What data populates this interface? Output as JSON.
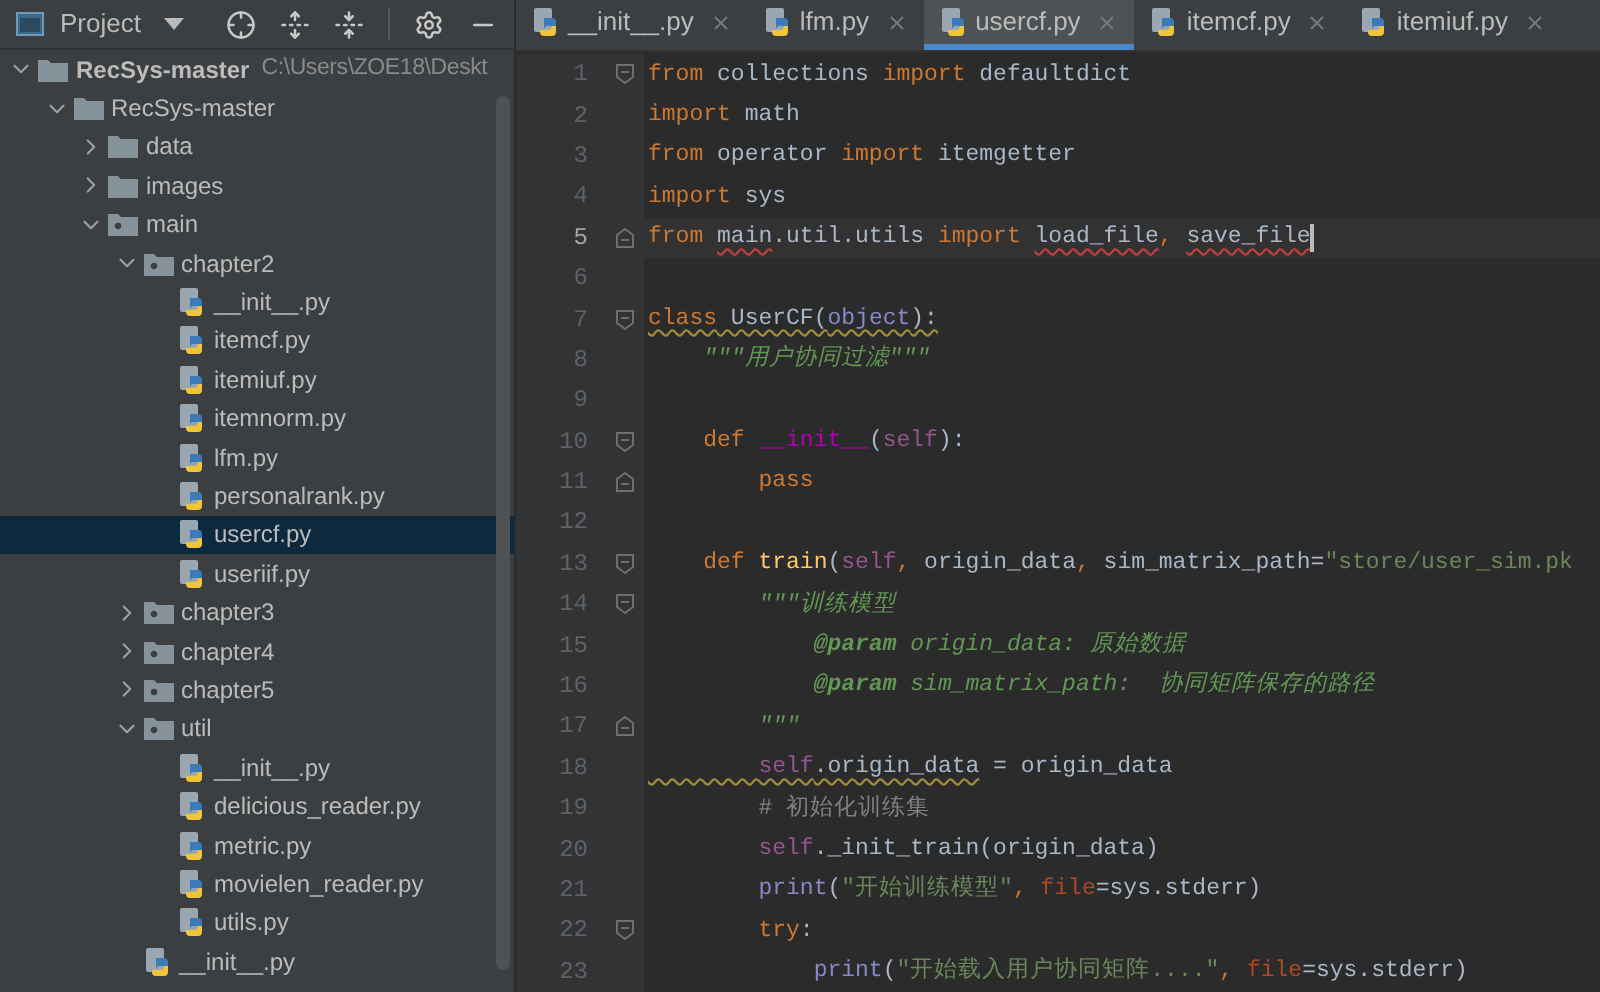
{
  "project_panel": {
    "title": "Project",
    "tree": [
      {
        "name": "RecSys-master",
        "path": "C:\\Users\\ZOE18\\Deskt",
        "kind": "folder",
        "expanded": true,
        "selected": false,
        "children": [
          {
            "name": "RecSys-master",
            "kind": "folder",
            "expanded": true,
            "selected": false,
            "children": [
              {
                "name": "data",
                "kind": "folder",
                "expanded": false,
                "selected": false
              },
              {
                "name": "images",
                "kind": "folder",
                "expanded": false,
                "selected": false
              },
              {
                "name": "main",
                "kind": "module",
                "expanded": true,
                "selected": false,
                "children": [
                  {
                    "name": "chapter2",
                    "kind": "module",
                    "expanded": true,
                    "selected": false,
                    "children": [
                      {
                        "name": "__init__.py",
                        "kind": "python",
                        "selected": false
                      },
                      {
                        "name": "itemcf.py",
                        "kind": "python",
                        "selected": false
                      },
                      {
                        "name": "itemiuf.py",
                        "kind": "python",
                        "selected": false
                      },
                      {
                        "name": "itemnorm.py",
                        "kind": "python",
                        "selected": false
                      },
                      {
                        "name": "lfm.py",
                        "kind": "python",
                        "selected": false
                      },
                      {
                        "name": "personalrank.py",
                        "kind": "python",
                        "selected": false
                      },
                      {
                        "name": "usercf.py",
                        "kind": "python",
                        "selected": true
                      },
                      {
                        "name": "useriif.py",
                        "kind": "python",
                        "selected": false
                      }
                    ]
                  },
                  {
                    "name": "chapter3",
                    "kind": "module",
                    "expanded": false,
                    "selected": false
                  },
                  {
                    "name": "chapter4",
                    "kind": "module",
                    "expanded": false,
                    "selected": false
                  },
                  {
                    "name": "chapter5",
                    "kind": "module",
                    "expanded": false,
                    "selected": false
                  },
                  {
                    "name": "util",
                    "kind": "module",
                    "expanded": true,
                    "selected": false,
                    "children": [
                      {
                        "name": "__init__.py",
                        "kind": "python",
                        "selected": false
                      },
                      {
                        "name": "delicious_reader.py",
                        "kind": "python",
                        "selected": false
                      },
                      {
                        "name": "metric.py",
                        "kind": "python",
                        "selected": false
                      },
                      {
                        "name": "movielen_reader.py",
                        "kind": "python",
                        "selected": false
                      },
                      {
                        "name": "utils.py",
                        "kind": "python",
                        "selected": false
                      }
                    ]
                  },
                  {
                    "name": "__init__.py",
                    "kind": "python",
                    "selected": false
                  }
                ]
              }
            ]
          }
        ]
      }
    ]
  },
  "editor_tabs": [
    {
      "label": "__init__.py",
      "selected": false
    },
    {
      "label": "lfm.py",
      "selected": false
    },
    {
      "label": "usercf.py",
      "selected": true
    },
    {
      "label": "itemcf.py",
      "selected": false
    },
    {
      "label": "itemiuf.py",
      "selected": false
    }
  ],
  "code_lines": [
    {
      "number": "1",
      "current": false,
      "fold_start": true,
      "fold_end": false,
      "tokens": [
        {
          "text": "from",
          "kind": "kw"
        },
        {
          "text": " collections ",
          "kind": "plain"
        },
        {
          "text": "import",
          "kind": "kw"
        },
        {
          "text": " defaultdict",
          "kind": "plain"
        }
      ]
    },
    {
      "number": "2",
      "current": false,
      "fold_start": false,
      "fold_end": false,
      "tokens": [
        {
          "text": "import",
          "kind": "kw"
        },
        {
          "text": " math",
          "kind": "plain"
        }
      ]
    },
    {
      "number": "3",
      "current": false,
      "fold_start": false,
      "fold_end": false,
      "tokens": [
        {
          "text": "from",
          "kind": "kw"
        },
        {
          "text": " operator ",
          "kind": "plain"
        },
        {
          "text": "import",
          "kind": "kw"
        },
        {
          "text": " itemgetter",
          "kind": "plain"
        }
      ]
    },
    {
      "number": "4",
      "current": false,
      "fold_start": false,
      "fold_end": false,
      "tokens": [
        {
          "text": "import",
          "kind": "kw"
        },
        {
          "text": " sys",
          "kind": "plain"
        }
      ]
    },
    {
      "number": "5",
      "current": true,
      "fold_start": false,
      "fold_end": true,
      "tokens": [
        {
          "text": "from ",
          "kind": "kw"
        },
        {
          "text": "main",
          "kind": "plain",
          "error": true
        },
        {
          "text": ".util.utils ",
          "kind": "plain"
        },
        {
          "text": "import ",
          "kind": "kw"
        },
        {
          "text": "load_file",
          "kind": "plain",
          "error": true
        },
        {
          "text": ", ",
          "kind": "kw"
        },
        {
          "text": "save_file",
          "kind": "plain",
          "error": true
        }
      ]
    },
    {
      "number": "6",
      "current": false,
      "fold_start": false,
      "fold_end": false
    },
    {
      "number": "7",
      "current": false,
      "fold_start": true,
      "fold_end": false,
      "tokens": [
        {
          "text": "class",
          "kind": "kw",
          "warning": true
        },
        {
          "text": " UserCF(",
          "kind": "plain",
          "warning": true
        },
        {
          "text": "object",
          "kind": "builtin",
          "warning": true
        },
        {
          "text": "):",
          "kind": "plain",
          "warning": true
        }
      ]
    },
    {
      "number": "8",
      "current": false,
      "fold_start": false,
      "fold_end": false,
      "tokens": [
        {
          "text": "    \"\"\"用户协同过滤\"\"\"",
          "kind": "doc"
        }
      ]
    },
    {
      "number": "9",
      "current": false,
      "fold_start": false,
      "fold_end": false
    },
    {
      "number": "10",
      "current": false,
      "fold_start": true,
      "fold_end": false,
      "tokens": [
        {
          "text": "    def ",
          "kind": "kw"
        },
        {
          "text": "__init__",
          "kind": "magic"
        },
        {
          "text": "(",
          "kind": "plain"
        },
        {
          "text": "self",
          "kind": "self"
        },
        {
          "text": "):",
          "kind": "plain"
        }
      ]
    },
    {
      "number": "11",
      "current": false,
      "fold_start": false,
      "fold_end": true,
      "tokens": [
        {
          "text": "        pass",
          "kind": "kw"
        }
      ]
    },
    {
      "number": "12",
      "current": false,
      "fold_start": false,
      "fold_end": false
    },
    {
      "number": "13",
      "current": false,
      "fold_start": true,
      "fold_end": false,
      "tokens": [
        {
          "text": "    def ",
          "kind": "kw"
        },
        {
          "text": "train",
          "kind": "fn"
        },
        {
          "text": "(",
          "kind": "plain"
        },
        {
          "text": "self",
          "kind": "self"
        },
        {
          "text": ",",
          "kind": "kw"
        },
        {
          "text": " origin_data",
          "kind": "plain"
        },
        {
          "text": ",",
          "kind": "kw"
        },
        {
          "text": " sim_matrix_path=",
          "kind": "plain"
        },
        {
          "text": "\"store/user_sim.pk",
          "kind": "str"
        }
      ]
    },
    {
      "number": "14",
      "current": false,
      "fold_start": true,
      "fold_end": false,
      "tokens": [
        {
          "text": "        \"\"\"训练模型",
          "kind": "doc"
        }
      ]
    },
    {
      "number": "15",
      "current": false,
      "fold_start": false,
      "fold_end": false,
      "tokens": [
        {
          "text": "            @param",
          "kind": "doctag"
        },
        {
          "text": " origin_data: 原始数据",
          "kind": "doc"
        }
      ]
    },
    {
      "number": "16",
      "current": false,
      "fold_start": false,
      "fold_end": false,
      "tokens": [
        {
          "text": "            @param",
          "kind": "doctag"
        },
        {
          "text": " sim_matrix_path:  协同矩阵保存的路径",
          "kind": "doc"
        }
      ]
    },
    {
      "number": "17",
      "current": false,
      "fold_start": false,
      "fold_end": true,
      "tokens": [
        {
          "text": "        \"\"\"",
          "kind": "doc"
        }
      ]
    },
    {
      "number": "18",
      "current": false,
      "fold_start": false,
      "fold_end": false,
      "tokens": [
        {
          "text": "        self",
          "kind": "self",
          "warning": true
        },
        {
          "text": ".origin_data",
          "kind": "plain",
          "warning": true
        },
        {
          "text": " = origin_data",
          "kind": "plain"
        }
      ]
    },
    {
      "number": "19",
      "current": false,
      "fold_start": false,
      "fold_end": false,
      "tokens": [
        {
          "text": "        # 初始化训练集",
          "kind": "comment"
        }
      ]
    },
    {
      "number": "20",
      "current": false,
      "fold_start": false,
      "fold_end": false,
      "tokens": [
        {
          "text": "        self",
          "kind": "self"
        },
        {
          "text": "._init_train(origin_data)",
          "kind": "plain"
        }
      ]
    },
    {
      "number": "21",
      "current": false,
      "fold_start": false,
      "fold_end": false,
      "tokens": [
        {
          "text": "        print",
          "kind": "builtin"
        },
        {
          "text": "(",
          "kind": "plain"
        },
        {
          "text": "\"开始训练模型\"",
          "kind": "str"
        },
        {
          "text": ", ",
          "kind": "kw"
        },
        {
          "text": "file",
          "kind": "kwarg"
        },
        {
          "text": "=sys.stderr)",
          "kind": "plain"
        }
      ]
    },
    {
      "number": "22",
      "current": false,
      "fold_start": true,
      "fold_end": false,
      "tokens": [
        {
          "text": "        try",
          "kind": "kw"
        },
        {
          "text": ":",
          "kind": "plain"
        }
      ]
    },
    {
      "number": "23",
      "current": false,
      "fold_start": false,
      "fold_end": false,
      "tokens": [
        {
          "text": "            print",
          "kind": "builtin"
        },
        {
          "text": "(",
          "kind": "plain"
        },
        {
          "text": "\"开始载入用户协同矩阵....\"",
          "kind": "str"
        },
        {
          "text": ", ",
          "kind": "kw"
        },
        {
          "text": "file",
          "kind": "kwarg"
        },
        {
          "text": "=sys.stderr)",
          "kind": "plain"
        }
      ]
    }
  ]
}
